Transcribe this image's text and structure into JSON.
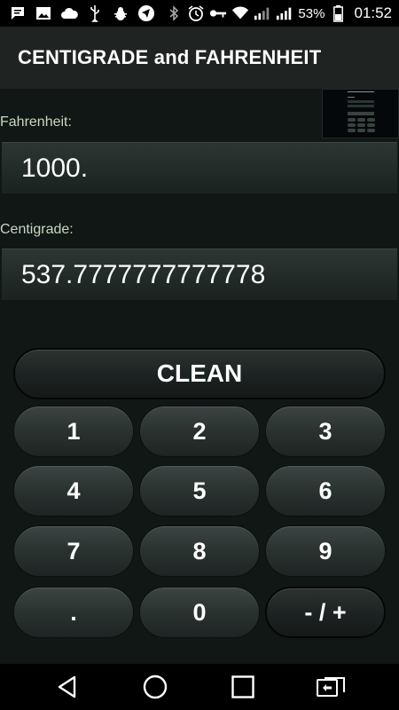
{
  "status_bar": {
    "battery_percent": "53%",
    "time": "01:52",
    "left_icons": [
      "chat-icon",
      "image-icon",
      "cloud-icon",
      "usb-icon",
      "android-debug-icon",
      "navigation-icon"
    ],
    "right_icons": [
      "bluetooth-icon",
      "alarm-icon",
      "key-icon",
      "wifi-icon",
      "signal-icon",
      "signal-2-icon",
      "battery-icon"
    ]
  },
  "app_bar": {
    "title": "CENTIGRADE and FAHRENHEIT"
  },
  "fahrenheit": {
    "label": "Fahrenheit:",
    "value": "1000."
  },
  "centigrade": {
    "label": "Centigrade:",
    "value": "537.7777777777778"
  },
  "keypad": {
    "clean": "CLEAN",
    "rows": [
      [
        "1",
        "2",
        "3"
      ],
      [
        "4",
        "5",
        "6"
      ],
      [
        "7",
        "8",
        "9"
      ],
      [
        ".",
        "0",
        "- / +"
      ]
    ]
  },
  "nav_bar": {
    "buttons": [
      "back-icon",
      "home-icon",
      "recents-icon",
      "switch-sim-icon"
    ]
  }
}
